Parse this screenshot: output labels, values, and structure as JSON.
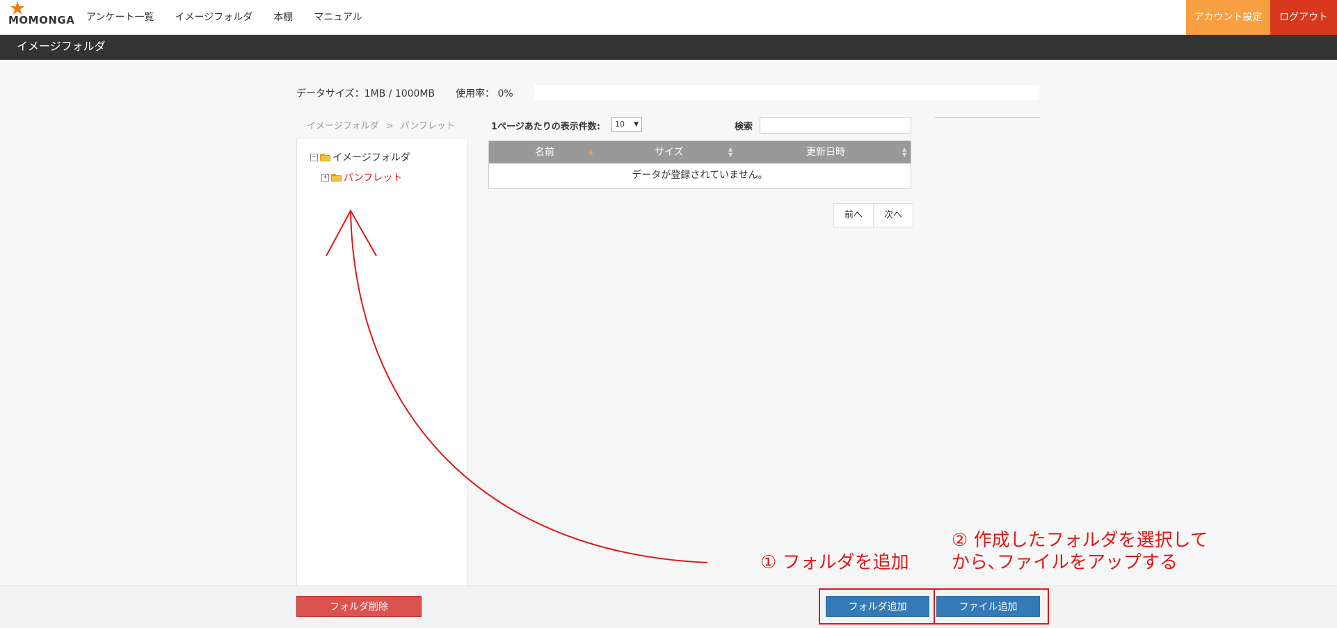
{
  "header": {
    "logo_text": "MOMONGA",
    "nav": [
      "アンケート一覧",
      "イメージフォルダ",
      "本棚",
      "マニュアル"
    ],
    "account_button": "アカウント設定",
    "logout_button": "ログアウト",
    "colors": {
      "account": "#f8a041",
      "logout": "#d8391e",
      "titlebar": "#333333"
    }
  },
  "page_title": "イメージフォルダ",
  "usage": {
    "data_size_text": "データサイズ：1MB / 1000MB",
    "rate_text": "使用率： 0%",
    "rate_fraction": 0
  },
  "breadcrumb": [
    "イメージフォルダ",
    "パンフレット"
  ],
  "breadcrumb_sep": ">",
  "tree": {
    "root": {
      "label": "イメージフォルダ",
      "toggle": "−",
      "icon": "folder-open-icon"
    },
    "children": [
      {
        "label": "パンフレット",
        "toggle": "+",
        "icon": "folder-icon",
        "selected": true,
        "color": "#e01818"
      }
    ]
  },
  "table": {
    "per_page_label": "1ページあたりの表示件数:",
    "per_page_value": "10",
    "search_label": "検索",
    "search_value": "",
    "columns": [
      "名前",
      "サイズ",
      "更新日時"
    ],
    "sort_up": "▲",
    "sort_both": "▲▼",
    "empty_text": "データが登録されていません。"
  },
  "pager": {
    "prev": "前へ",
    "next": "次へ"
  },
  "footer": {
    "delete_folder": "フォルダ削除",
    "add_folder": "フォルダ追加",
    "add_file": "ファイル追加"
  },
  "annotations": {
    "note1": "① フォルダを追加",
    "note2_line1": "② 作成したフォルダを選択して",
    "note2_line2": "から､ファイルをアップする",
    "color": "#e01818"
  }
}
